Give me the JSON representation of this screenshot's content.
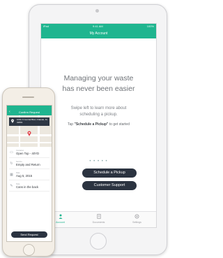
{
  "tablet": {
    "status_left": "iPad",
    "status_time": "9:41 AM",
    "status_right": "100%",
    "nav_title": "My Account",
    "headline_line1": "Managing your waste",
    "headline_line2": "has never been easier",
    "sub_line1": "Swipe left to learn more about",
    "sub_line2": "scheduling a pickup.",
    "tap_prefix": "Tap",
    "tap_bold": "\"Schedule a Pickup\"",
    "tap_suffix": "to get started",
    "page_dots": "• • • • •",
    "schedule_button": "Schedule a Pickup",
    "support_button": "Customer Support",
    "tabs": [
      {
        "label": "Account",
        "icon": "account-icon"
      },
      {
        "label": "Documents",
        "icon": "documents-icon"
      },
      {
        "label": "Settings",
        "icon": "settings-icon"
      }
    ]
  },
  "phone": {
    "nav_title": "Confirm Request",
    "back_glyph": "‹",
    "address_line1": "1031 N Central Blvd, Orlando, FL",
    "address_line2": "32801",
    "rows": [
      {
        "label": "Container",
        "value": "Open Top - 40YD",
        "icon": "container-icon"
      },
      {
        "label": "Service",
        "value": "Empty and Return",
        "icon": "service-icon"
      },
      {
        "label": "Date",
        "value": "Aug 5, 2015",
        "icon": "calendar-icon"
      },
      {
        "label": "Note",
        "value": "Cans in the back",
        "icon": "note-icon"
      }
    ],
    "send_button": "Send Request"
  },
  "colors": {
    "accent": "#1fb58f",
    "dark_button": "#2b3340",
    "map_pin": "#e0444c"
  }
}
